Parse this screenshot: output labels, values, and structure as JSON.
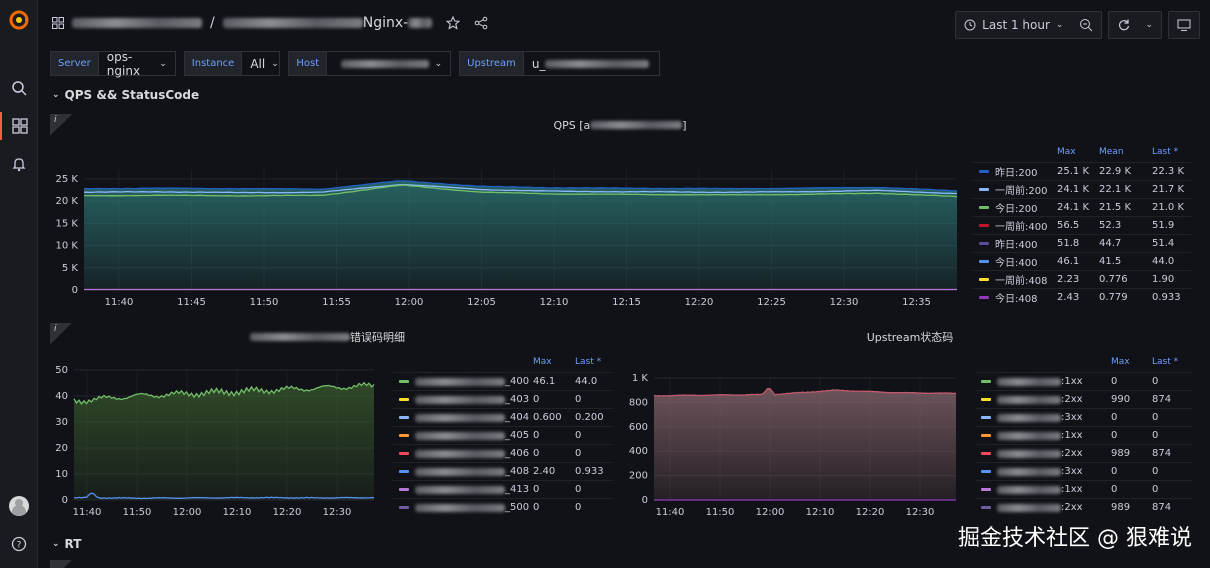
{
  "topbar": {
    "title_suffix": "Nginx-",
    "time_range": "Last 1 hour"
  },
  "variables": [
    {
      "label": "Server",
      "value": "ops-nginx"
    },
    {
      "label": "Instance",
      "value": "All"
    },
    {
      "label": "Host",
      "value": ""
    },
    {
      "label": "Upstream",
      "value": "u_"
    }
  ],
  "rows": {
    "qps": "QPS && StatusCode",
    "rt": "RT"
  },
  "qps_panel": {
    "title": "QPS [a",
    "title_end": "]",
    "y_ticks": [
      "25 K",
      "20 K",
      "15 K",
      "10 K",
      "5 K",
      "0"
    ],
    "x_ticks": [
      "11:40",
      "11:45",
      "11:50",
      "11:55",
      "12:00",
      "12:05",
      "12:10",
      "12:15",
      "12:20",
      "12:25",
      "12:30",
      "12:35"
    ],
    "legend_headers": {
      "max": "Max",
      "mean": "Mean",
      "last": "Last *"
    },
    "legend": [
      {
        "name": "昨日:200",
        "color": "#1f60c4",
        "max": "25.1 K",
        "mean": "22.9 K",
        "last": "22.3 K"
      },
      {
        "name": "一周前:200",
        "color": "#8ab8ff",
        "max": "24.1 K",
        "mean": "22.1 K",
        "last": "21.7 K"
      },
      {
        "name": "今日:200",
        "color": "#73bf69",
        "max": "24.1 K",
        "mean": "21.5 K",
        "last": "21.0 K"
      },
      {
        "name": "一周前:400",
        "color": "#c4162a",
        "max": "56.5",
        "mean": "52.3",
        "last": "51.9"
      },
      {
        "name": "昨日:400",
        "color": "#5a4a9a",
        "max": "51.8",
        "mean": "44.7",
        "last": "51.4"
      },
      {
        "name": "今日:400",
        "color": "#5794f2",
        "max": "46.1",
        "mean": "41.5",
        "last": "44.0"
      },
      {
        "name": "一周前:408",
        "color": "#fade2a",
        "max": "2.23",
        "mean": "0.776",
        "last": "1.90"
      },
      {
        "name": "今日:408",
        "color": "#8f3bb8",
        "max": "2.43",
        "mean": "0.779",
        "last": "0.933"
      }
    ]
  },
  "err_panel": {
    "title": "错误码明细",
    "y_ticks": [
      "50",
      "40",
      "30",
      "20",
      "10",
      "0"
    ],
    "x_ticks": [
      "11:40",
      "11:50",
      "12:00",
      "12:10",
      "12:20",
      "12:30"
    ],
    "legend_headers": {
      "max": "Max",
      "last": "Last *"
    },
    "legend": [
      {
        "suffix": "_400",
        "color": "#73bf69",
        "max": "46.1",
        "last": "44.0"
      },
      {
        "suffix": "_403",
        "color": "#fade2a",
        "max": "0",
        "last": "0"
      },
      {
        "suffix": "_404",
        "color": "#8ab8ff",
        "max": "0.600",
        "last": "0.200"
      },
      {
        "suffix": "_405",
        "color": "#ff9830",
        "max": "0",
        "last": "0"
      },
      {
        "suffix": "_406",
        "color": "#f2495c",
        "max": "0",
        "last": "0"
      },
      {
        "suffix": "_408",
        "color": "#5794f2",
        "max": "2.40",
        "last": "0.933"
      },
      {
        "suffix": "_413",
        "color": "#b877d9",
        "max": "0",
        "last": "0"
      },
      {
        "suffix": "_500",
        "color": "#705da0",
        "max": "0",
        "last": "0"
      }
    ]
  },
  "up_panel": {
    "title": "Upstream状态码",
    "y_ticks": [
      "1 K",
      "800",
      "600",
      "400",
      "200",
      "0"
    ],
    "x_ticks": [
      "11:40",
      "11:50",
      "12:00",
      "12:10",
      "12:20",
      "12:30"
    ],
    "legend_headers": {
      "max": "Max",
      "last": "Last *"
    },
    "legend": [
      {
        "suffix": ":1xx",
        "color": "#73bf69",
        "max": "0",
        "last": "0"
      },
      {
        "suffix": ":2xx",
        "color": "#fade2a",
        "max": "990",
        "last": "874"
      },
      {
        "suffix": ":3xx",
        "color": "#8ab8ff",
        "max": "0",
        "last": "0"
      },
      {
        "suffix": ":1xx",
        "color": "#ff9830",
        "max": "0",
        "last": "0"
      },
      {
        "suffix": ":2xx",
        "color": "#f2495c",
        "max": "989",
        "last": "874"
      },
      {
        "suffix": ":3xx",
        "color": "#5794f2",
        "max": "0",
        "last": "0"
      },
      {
        "suffix": ":1xx",
        "color": "#b877d9",
        "max": "0",
        "last": "0"
      },
      {
        "suffix": ":2xx",
        "color": "#705da0",
        "max": "989",
        "last": "874"
      }
    ]
  },
  "watermark": "掘金技术社区 @ 狠难说",
  "chart_data": [
    {
      "type": "area",
      "x": [
        "11:40",
        "11:45",
        "11:50",
        "11:55",
        "12:00",
        "12:05",
        "12:10",
        "12:15",
        "12:20",
        "12:25",
        "12:30",
        "12:35"
      ],
      "ylim": [
        0,
        27000
      ],
      "series": [
        {
          "name": "昨日:200",
          "values": [
            22800,
            22900,
            22800,
            22700,
            24600,
            23300,
            23000,
            22900,
            22800,
            22900,
            23100,
            22300
          ]
        },
        {
          "name": "一周前:200",
          "values": [
            22000,
            22100,
            21900,
            22000,
            23800,
            22600,
            22200,
            22100,
            22000,
            22100,
            22400,
            21700
          ]
        },
        {
          "name": "今日:200",
          "values": [
            21200,
            21300,
            21200,
            21300,
            23600,
            22000,
            21600,
            21500,
            21400,
            21500,
            21800,
            21000
          ]
        }
      ]
    },
    {
      "type": "line",
      "x": [
        "11:40",
        "11:50",
        "12:00",
        "12:10",
        "12:20",
        "12:30"
      ],
      "ylim": [
        0,
        50
      ],
      "series": [
        {
          "name": "_400",
          "values": [
            38,
            40,
            41,
            42,
            43,
            44
          ]
        },
        {
          "name": "_408",
          "values": [
            0.9,
            0.7,
            0.8,
            0.9,
            0.8,
            0.9
          ]
        }
      ]
    },
    {
      "type": "area",
      "x": [
        "11:40",
        "11:50",
        "12:00",
        "12:10",
        "12:20",
        "12:30"
      ],
      "ylim": [
        0,
        1000
      ],
      "series": [
        {
          "name": ":2xx",
          "values": [
            855,
            860,
            865,
            900,
            880,
            874
          ]
        }
      ]
    }
  ]
}
